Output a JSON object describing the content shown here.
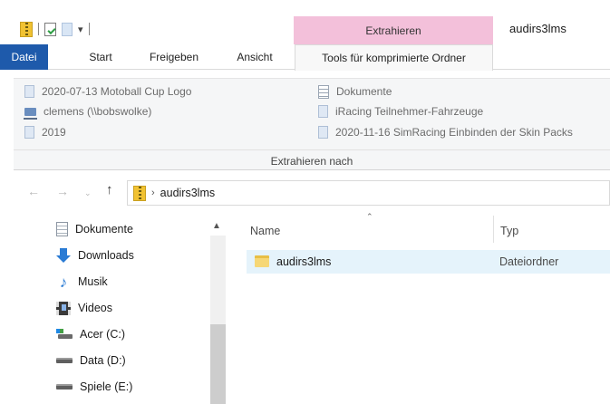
{
  "window": {
    "title": "audirs3lms",
    "contextual_tab_header": "Extrahieren"
  },
  "ribbon_tabs": [
    "Datei",
    "Start",
    "Freigeben",
    "Ansicht",
    "Tools für komprimierte Ordner"
  ],
  "ribbon": {
    "extract_destinations": [
      {
        "label": "2020-07-13 Motoball Cup Logo",
        "icon": "folder-icon"
      },
      {
        "label": "clemens (\\\\bobswolke)",
        "icon": "network-drive-icon"
      },
      {
        "label": "2019",
        "icon": "folder-icon"
      },
      {
        "label": "Dokumente",
        "icon": "documents-icon"
      },
      {
        "label": "iRacing Teilnehmer-Fahrzeuge",
        "icon": "folder-icon"
      },
      {
        "label": "2020-11-16 SimRacing Einbinden der Skin Packs",
        "icon": "folder-icon"
      }
    ],
    "group_label": "Extrahieren nach"
  },
  "address_bar": {
    "path": "audirs3lms"
  },
  "nav_pane": {
    "items": [
      {
        "label": "Dokumente",
        "icon": "documents-icon"
      },
      {
        "label": "Downloads",
        "icon": "downloads-icon"
      },
      {
        "label": "Musik",
        "icon": "music-icon"
      },
      {
        "label": "Videos",
        "icon": "videos-icon"
      },
      {
        "label": "Acer (C:)",
        "icon": "system-drive-icon"
      },
      {
        "label": "Data (D:)",
        "icon": "drive-icon"
      },
      {
        "label": "Spiele (E:)",
        "icon": "drive-icon"
      }
    ]
  },
  "file_list": {
    "columns": [
      "Name",
      "Typ"
    ],
    "rows": [
      {
        "name": "audirs3lms",
        "type": "Dateiordner"
      }
    ]
  },
  "colors": {
    "file_tab": "#1e5aab",
    "contextual_header": "#f3c0da",
    "selection": "#e5f3fb"
  }
}
